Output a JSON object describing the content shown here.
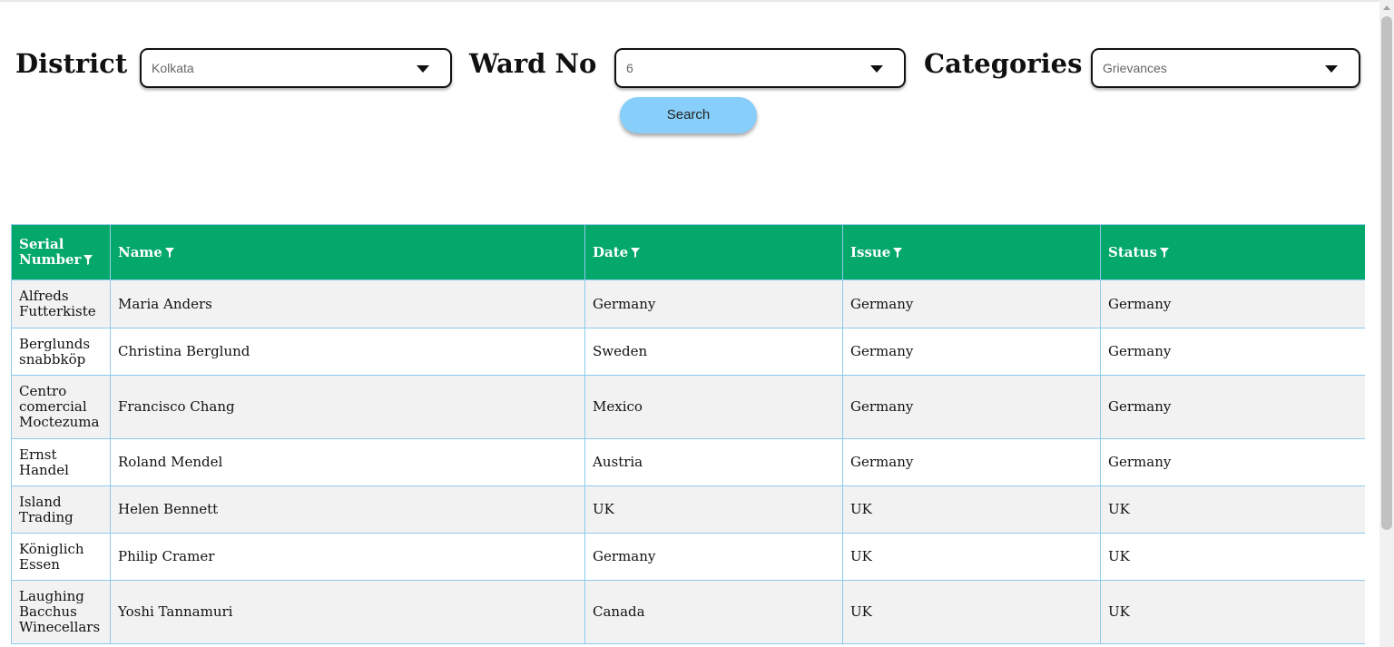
{
  "filters": {
    "district": {
      "label": "District",
      "value": "Kolkata"
    },
    "ward": {
      "label": "Ward No",
      "value": "6"
    },
    "category": {
      "label": "Categories",
      "value": "Grievances"
    },
    "search_label": "Search"
  },
  "table": {
    "headers": {
      "serial_line1": "Serial",
      "serial_line2": "Number",
      "name": "Name",
      "date": "Date",
      "issue": "Issue",
      "status": "Status"
    },
    "rows": [
      {
        "serial": [
          "Alfreds",
          "Futterkiste"
        ],
        "name": "Maria Anders",
        "date": "Germany",
        "issue": "Germany",
        "status": "Germany"
      },
      {
        "serial": [
          "Berglunds",
          "snabbköp"
        ],
        "name": "Christina Berglund",
        "date": "Sweden",
        "issue": "Germany",
        "status": "Germany"
      },
      {
        "serial": [
          "Centro",
          "comercial",
          "Moctezuma"
        ],
        "name": "Francisco Chang",
        "date": "Mexico",
        "issue": "Germany",
        "status": "Germany"
      },
      {
        "serial": [
          "Ernst",
          "Handel"
        ],
        "name": "Roland Mendel",
        "date": "Austria",
        "issue": "Germany",
        "status": "Germany"
      },
      {
        "serial": [
          "Island",
          "Trading"
        ],
        "name": "Helen Bennett",
        "date": "UK",
        "issue": "UK",
        "status": "UK"
      },
      {
        "serial": [
          "Königlich",
          "Essen"
        ],
        "name": "Philip Cramer",
        "date": "Germany",
        "issue": "UK",
        "status": "UK"
      },
      {
        "serial": [
          "Laughing",
          "Bacchus",
          "Winecellars"
        ],
        "name": "Yoshi Tannamuri",
        "date": "Canada",
        "issue": "UK",
        "status": "UK"
      }
    ]
  },
  "colors": {
    "header_bg": "#04a86b",
    "search_button": "#87cefa",
    "row_alt": "#f2f2f2",
    "cell_border": "#8ec9ee"
  },
  "icons": {
    "dropdown": "caret-down-icon",
    "filter": "funnel-icon"
  }
}
